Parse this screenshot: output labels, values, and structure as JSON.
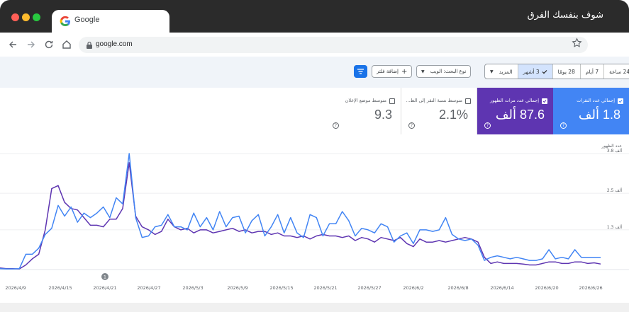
{
  "overlay_title": "شوف بنفسك الفرق",
  "browser": {
    "tab_title": "Google",
    "url": "google.com"
  },
  "toolbar": {
    "date_ranges": [
      "24 ساعة",
      "7 أيام",
      "28 يومًا",
      "3 أشهر",
      "المزيد"
    ],
    "active_range": "3 أشهر",
    "search_type_chip": "نوع البحث: الويب",
    "add_filter": "إضافة فلتر"
  },
  "cards": [
    {
      "label": "إجمالي عدد النقرات",
      "value": "1.8 ألف",
      "checked": true
    },
    {
      "label": "إجمالي عدد مرات الظهور",
      "value": "87.6 ألف",
      "checked": true
    },
    {
      "label": "متوسط نسبة النقر إلى الظ...",
      "value": "2.1%",
      "checked": false
    },
    {
      "label": "متوسط موضع الإعلان",
      "value": "9.3",
      "checked": false
    }
  ],
  "colors": {
    "clicks": "#4285f4",
    "impressions": "#5e35b1",
    "accent": "#1a73e8"
  },
  "chart_data": {
    "type": "line",
    "y_axis_title": "عدد الظهور",
    "y_ticks": [
      "3.8 ألف",
      "2.5 ألف",
      "1.3 ألف"
    ],
    "y_tick_values": [
      3800,
      2500,
      1300
    ],
    "y_range": [
      0,
      3800
    ],
    "x_ticks": [
      "2026/4/9",
      "2026/4/15",
      "2026/4/21",
      "2026/4/27",
      "2026/5/3",
      "2026/5/9",
      "2026/5/15",
      "2026/5/21",
      "2026/5/27",
      "2026/6/2",
      "2026/6/8",
      "2026/6/14",
      "2026/6/20",
      "2026/6/26"
    ],
    "annotation_marker": "1",
    "series": [
      {
        "name": "إجمالي عدد مرات الظهور",
        "color": "#5e35b1",
        "values": [
          50,
          30,
          30,
          20,
          150,
          350,
          500,
          1300,
          2650,
          2750,
          2200,
          2000,
          1950,
          1700,
          1450,
          1450,
          1400,
          1650,
          1650,
          2000,
          3500,
          1750,
          1400,
          1300,
          1150,
          1250,
          1650,
          1400,
          1300,
          1350,
          1200,
          1300,
          1300,
          1200,
          1250,
          1300,
          1350,
          1250,
          1300,
          1200,
          1250,
          1250,
          1150,
          1200,
          1100,
          1100,
          1050,
          1100,
          1000,
          1100,
          1150,
          1100,
          1100,
          1050,
          1100,
          950,
          1050,
          1000,
          900,
          1050,
          1000,
          950,
          1050,
          850,
          750,
          1000,
          900,
          900,
          950,
          900,
          950,
          1000,
          1050,
          1000,
          900,
          400,
          200,
          250,
          200,
          200,
          200,
          180,
          150,
          150,
          200,
          250,
          250,
          200,
          200,
          250,
          250,
          200,
          220,
          180
        ]
      },
      {
        "name": "إجمالي عدد النقرات",
        "color": "#4285f4",
        "values": [
          30,
          20,
          20,
          30,
          500,
          500,
          700,
          1150,
          1350,
          2100,
          1750,
          2050,
          1550,
          1850,
          1700,
          1850,
          2050,
          1700,
          2350,
          2150,
          3800,
          1700,
          1050,
          1100,
          1400,
          1450,
          1800,
          1400,
          1400,
          1300,
          1850,
          1400,
          1700,
          1300,
          1900,
          1400,
          1700,
          1750,
          1200,
          1600,
          1800,
          1100,
          1400,
          1800,
          1200,
          1700,
          1200,
          1050,
          1800,
          1700,
          1100,
          1500,
          1500,
          1900,
          1600,
          1100,
          1350,
          1300,
          1200,
          1500,
          1400,
          900,
          1100,
          1200,
          850,
          1300,
          1300,
          1250,
          1300,
          1700,
          1150,
          1000,
          950,
          1000,
          800,
          300,
          400,
          450,
          400,
          350,
          400,
          350,
          300,
          300,
          350,
          650,
          350,
          400,
          350,
          650,
          400,
          400,
          400,
          400
        ]
      }
    ]
  }
}
